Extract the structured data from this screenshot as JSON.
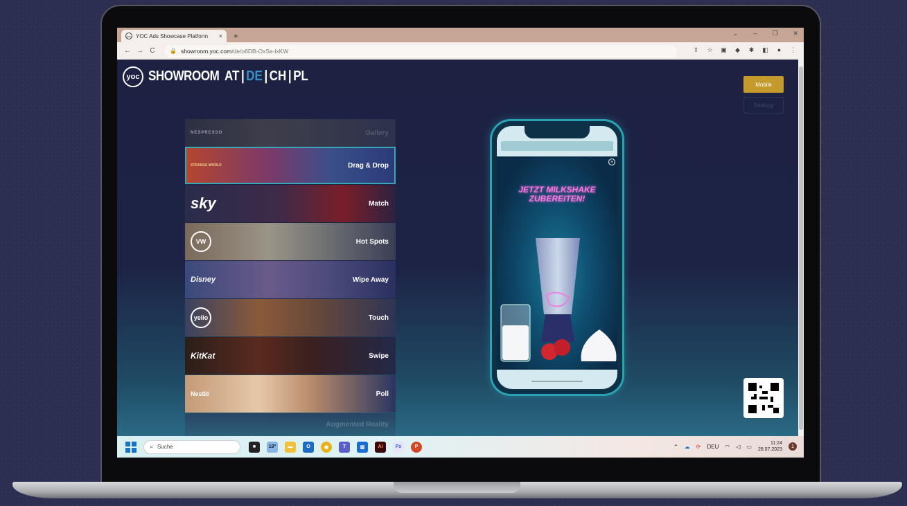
{
  "browser": {
    "tab_title": "YOC Ads Showcase Platform",
    "tab_close": "×",
    "new_tab": "+",
    "url_host": "showroom.yoc.com",
    "url_path": "/de/o6DB-OxSe-lxKW",
    "window_controls": [
      "⌄",
      "–",
      "❐",
      "✕"
    ],
    "nav": [
      "←",
      "→",
      "C"
    ]
  },
  "header": {
    "logo": "yoc",
    "brand": "SHOWROOM",
    "countries": [
      "AT",
      "DE",
      "CH",
      "PL"
    ],
    "active_country": "DE"
  },
  "view_buttons": {
    "mobile": "Mobile",
    "desktop": "Desktop"
  },
  "formats": [
    {
      "label": "Gallery",
      "brand": "NESPRESSO"
    },
    {
      "label": "Drag & Drop",
      "brand": "STRANGE WORLD"
    },
    {
      "label": "Match",
      "brand": "sky"
    },
    {
      "label": "Hot Spots",
      "brand": "VW"
    },
    {
      "label": "Wipe Away",
      "brand": "Disney"
    },
    {
      "label": "Touch",
      "brand": "yello"
    },
    {
      "label": "Swipe",
      "brand": "KitKat"
    },
    {
      "label": "Poll",
      "brand": "Nestlé"
    },
    {
      "label": "Augmented Reality",
      "brand": ""
    }
  ],
  "ad": {
    "headline_1": "JETZT MILKSHAKE",
    "headline_2": "ZUBEREITEN!"
  },
  "taskbar": {
    "search_placeholder": "Suche",
    "weather": "19°",
    "language": "DEU",
    "time": "11:24",
    "date": "28.07.2023",
    "notifications": "1"
  },
  "colors": {
    "accent": "#3a8fc8",
    "mobile_button": "#c49a2c",
    "phone_frame": "#2aa2b4",
    "headline": "#f07ce0"
  }
}
